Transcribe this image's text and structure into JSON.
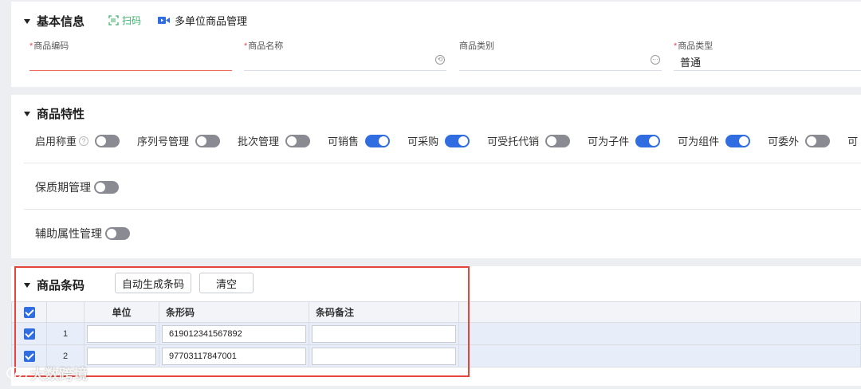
{
  "basic": {
    "title": "基本信息",
    "scan_label": "扫码",
    "multi_unit_label": "多单位商品管理",
    "fields": [
      {
        "label": "商品编码",
        "required": true,
        "value": ""
      },
      {
        "label": "商品名称",
        "required": true,
        "value": ""
      },
      {
        "label": "商品类别",
        "required": false,
        "value": ""
      },
      {
        "label": "商品类型",
        "required": true,
        "value": "普通"
      }
    ]
  },
  "features": {
    "title": "商品特性",
    "toggles": [
      {
        "label": "启用称重",
        "on": false,
        "help": true
      },
      {
        "label": "序列号管理",
        "on": false
      },
      {
        "label": "批次管理",
        "on": false
      },
      {
        "label": "可销售",
        "on": true
      },
      {
        "label": "可采购",
        "on": true
      },
      {
        "label": "可受托代销",
        "on": false
      },
      {
        "label": "可为子件",
        "on": true
      },
      {
        "label": "可为组件",
        "on": true
      },
      {
        "label": "可委外",
        "on": false
      },
      {
        "label": "可",
        "on": false
      }
    ],
    "shelf_life": "保质期管理",
    "aux_attr": "辅助属性管理"
  },
  "barcode": {
    "title": "商品条码",
    "auto_btn": "自动生成条码",
    "clear_btn": "清空",
    "columns": [
      "单位",
      "条形码",
      "条码备注"
    ],
    "rows": [
      {
        "index": "1",
        "unit": "",
        "barcode": "619012341567892",
        "note": ""
      },
      {
        "index": "2",
        "unit": "",
        "barcode": "97703117847001",
        "note": ""
      }
    ]
  },
  "watermark": "大数跨境",
  "colors": {
    "accent": "#2f6de0",
    "highlight": "#e5453b",
    "scan": "#3bb36b",
    "required": "#e34d59"
  }
}
